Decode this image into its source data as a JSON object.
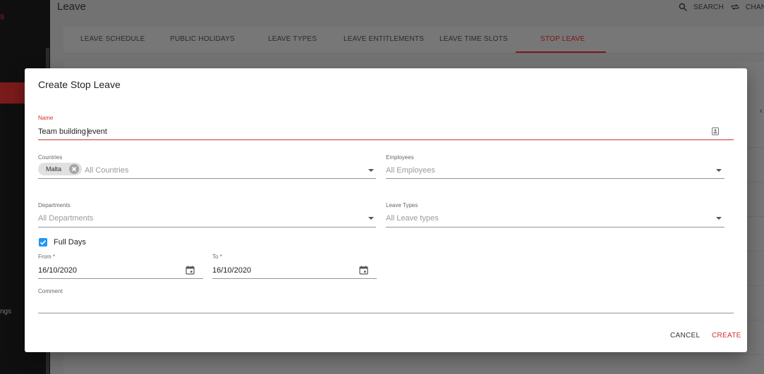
{
  "sidebar": {
    "brand_fragment": "s",
    "item_fragment": "ngs"
  },
  "header": {
    "title": "Leave",
    "search_label": "SEARCH",
    "change_label": "CHAN"
  },
  "tabs": [
    {
      "label": "LEAVE SCHEDULE"
    },
    {
      "label": "PUBLIC HOLIDAYS"
    },
    {
      "label": "LEAVE TYPES"
    },
    {
      "label": "LEAVE ENTITLEMENTS"
    },
    {
      "label": "LEAVE TIME SLOTS"
    },
    {
      "label": "STOP LEAVE",
      "active": true
    }
  ],
  "dialog": {
    "title": "Create Stop Leave",
    "name": {
      "label": "Name",
      "value": "Team building event"
    },
    "countries": {
      "label": "Countries",
      "chip": "Malta",
      "placeholder": "All Countries"
    },
    "employees": {
      "label": "Employees",
      "placeholder": "All Employees"
    },
    "departments": {
      "label": "Departments",
      "placeholder": "All Departments"
    },
    "leave_types": {
      "label": "Leave Types",
      "placeholder": "All Leave types"
    },
    "full_days": {
      "label": "Full Days",
      "checked": true
    },
    "from": {
      "label": "From *",
      "value": "16/10/2020"
    },
    "to": {
      "label": "To *",
      "value": "16/10/2020"
    },
    "comment": {
      "label": "Comment",
      "value": ""
    },
    "cancel_label": "CANCEL",
    "create_label": "CREATE"
  },
  "colors": {
    "accent": "#d32f2f",
    "checkbox": "#2196f3",
    "sidebar_bg": "#0f0f0f"
  },
  "icons": {
    "search": "search-icon",
    "change": "swap-icon",
    "calendar": "calendar-icon",
    "chip_remove": "close-circle-icon",
    "name_field": "contact-card-icon",
    "dropdown": "chevron-down-icon"
  }
}
